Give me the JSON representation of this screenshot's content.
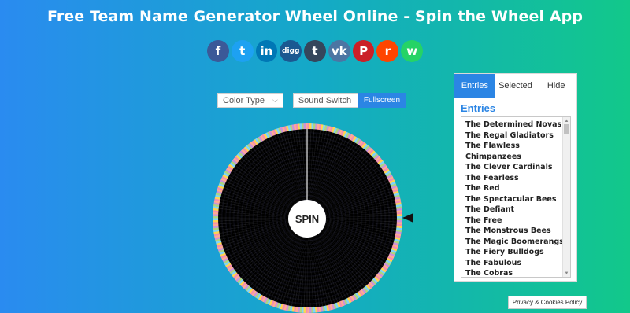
{
  "title": "Free Team Name Generator Wheel Online - Spin the Wheel App",
  "social": [
    {
      "name": "facebook",
      "glyph": "f",
      "color": "#3b5998"
    },
    {
      "name": "twitter",
      "glyph": "t",
      "color": "#1da1f2"
    },
    {
      "name": "linkedin",
      "glyph": "in",
      "color": "#0077b5"
    },
    {
      "name": "digg",
      "glyph": "digg",
      "color": "#1b5891"
    },
    {
      "name": "tumblr",
      "glyph": "t",
      "color": "#35465c"
    },
    {
      "name": "vk",
      "glyph": "vk",
      "color": "#4c75a3"
    },
    {
      "name": "pinterest",
      "glyph": "P",
      "color": "#cb2027"
    },
    {
      "name": "reddit",
      "glyph": "r",
      "color": "#ff4500"
    },
    {
      "name": "whatsapp",
      "glyph": "w",
      "color": "#25d366"
    }
  ],
  "controls": {
    "color_type": "Color Type",
    "sound_switch": "Sound Switch",
    "fullscreen": "Fullscreen"
  },
  "wheel": {
    "spin_label": "SPIN"
  },
  "panel": {
    "tabs": [
      "Entries",
      "Selected",
      "Hide"
    ],
    "active_tab": "Entries",
    "heading": "Entries",
    "entries": [
      "The Determined Novas",
      "The Regal Gladiators",
      "The Flawless",
      "Chimpanzees",
      "The Clever Cardinals",
      "The Fearless",
      "The Red",
      "The Spectacular Bees",
      "The Defiant",
      "The Free",
      "The Monstrous Bees",
      "The Magic Boomerangs",
      "The Fiery Bulldogs",
      "The Fabulous",
      "The Cobras"
    ]
  },
  "privacy": "Privacy & Cookies Policy"
}
